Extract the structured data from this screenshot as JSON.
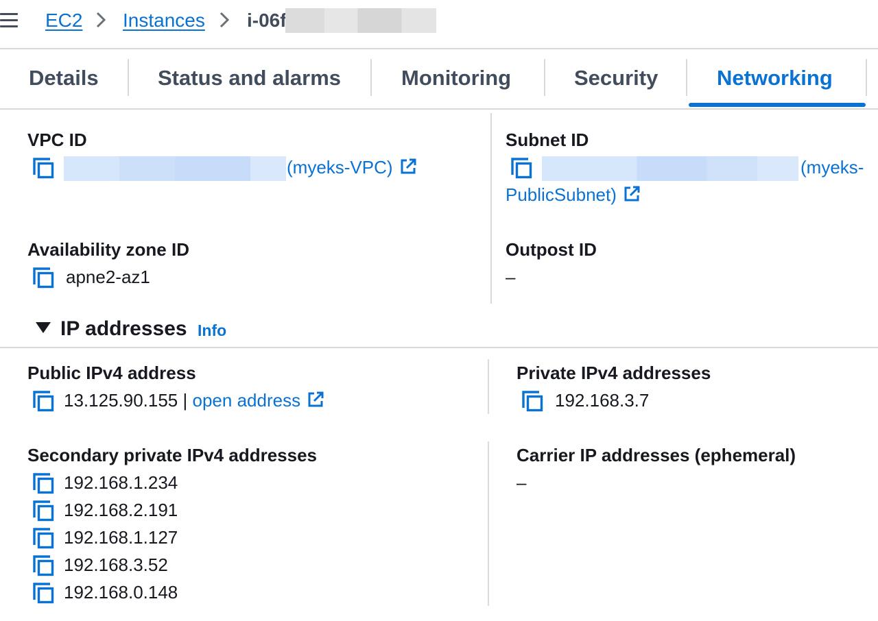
{
  "breadcrumb": {
    "items": [
      "EC2",
      "Instances"
    ],
    "current": "i-06f"
  },
  "tabs": [
    "Details",
    "Status and alarms",
    "Monitoring",
    "Security",
    "Networking"
  ],
  "active_tab": "Networking",
  "details": {
    "vpc_label": "VPC ID",
    "vpc_name": "(myeks-VPC)",
    "subnet_label": "Subnet ID",
    "subnet_name_line1": "(myeks-",
    "subnet_name_line2": "PublicSubnet)",
    "az_label": "Availability zone ID",
    "az_value": "apne2-az1",
    "outpost_label": "Outpost ID",
    "outpost_value": "–"
  },
  "ip_section": {
    "title": "IP addresses",
    "info": "Info",
    "public_label": "Public IPv4 address",
    "public_value": "13.125.90.155",
    "public_sep": "|",
    "open_address": "open address",
    "private_label": "Private IPv4 addresses",
    "private_value": "192.168.3.7",
    "secondary_label": "Secondary private IPv4 addresses",
    "secondary_values": [
      "192.168.1.234",
      "192.168.2.191",
      "192.168.1.127",
      "192.168.3.52",
      "192.168.0.148"
    ],
    "carrier_label": "Carrier IP addresses (ephemeral)",
    "carrier_value": "–"
  },
  "icons": {
    "copy": "copy-icon",
    "external_link": "external-link-icon",
    "caret": "caret-down-icon",
    "menu": "menu-icon",
    "chevron": "chevron-right-icon"
  },
  "colors": {
    "link": "#0972d3",
    "text": "#16191f",
    "muted": "#414d5c",
    "border": "#d5dbdb"
  }
}
